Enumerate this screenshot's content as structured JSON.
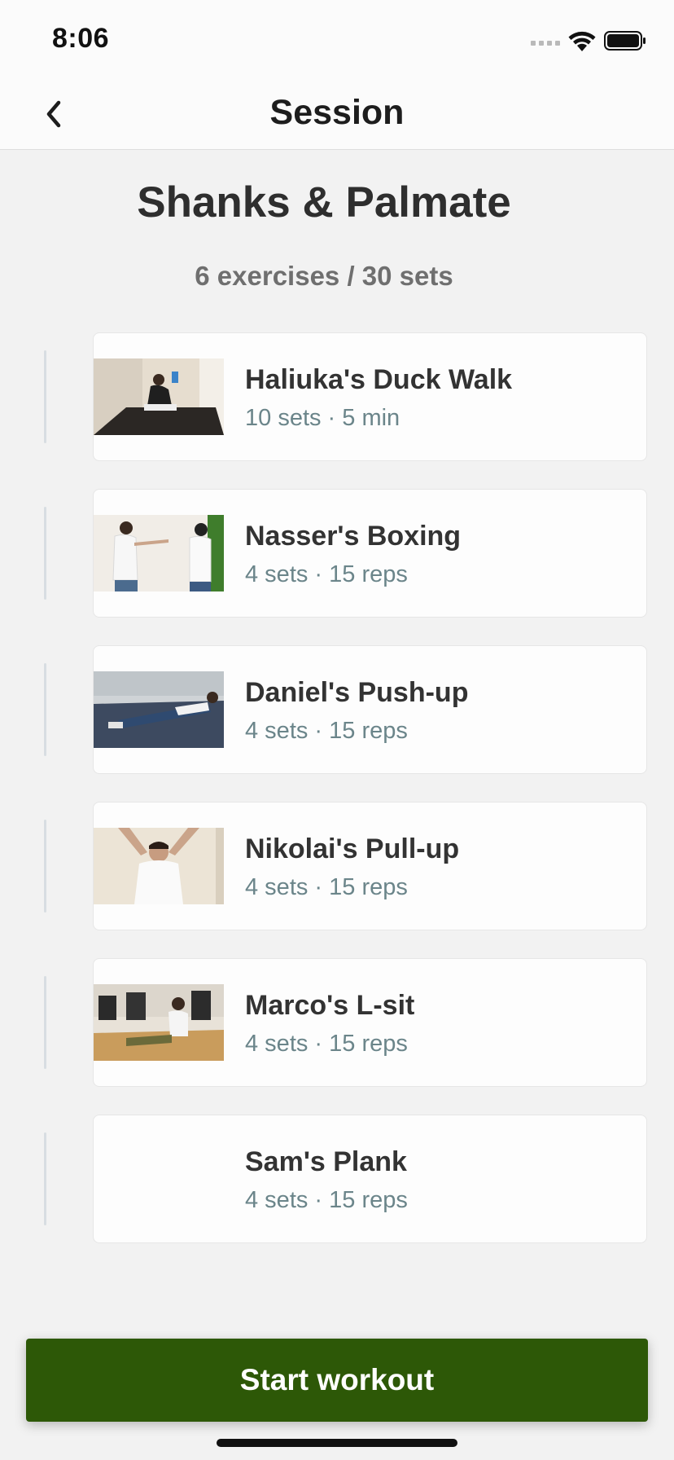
{
  "status_bar": {
    "time": "8:06"
  },
  "nav": {
    "title": "Session",
    "back_icon": "chevron-left-icon"
  },
  "workout": {
    "title": "Shanks & Palmate",
    "summary": "6 exercises / 30 sets"
  },
  "exercises": [
    {
      "name": "Haliuka's Duck Walk",
      "detail": "10 sets · 5 min",
      "has_thumbnail": true
    },
    {
      "name": "Nasser's Boxing",
      "detail": "4 sets · 15 reps",
      "has_thumbnail": true
    },
    {
      "name": "Daniel's Push-up",
      "detail": "4 sets · 15 reps",
      "has_thumbnail": true
    },
    {
      "name": "Nikolai's Pull-up",
      "detail": "4 sets · 15 reps",
      "has_thumbnail": true
    },
    {
      "name": "Marco's L-sit",
      "detail": "4 sets · 15 reps",
      "has_thumbnail": true
    },
    {
      "name": "Sam's Plank",
      "detail": "4 sets · 15 reps",
      "has_thumbnail": false
    }
  ],
  "actions": {
    "start_label": "Start workout"
  },
  "colors": {
    "accent": "#2d5807",
    "detail_text": "#6b858a",
    "background": "#f2f2f2"
  }
}
